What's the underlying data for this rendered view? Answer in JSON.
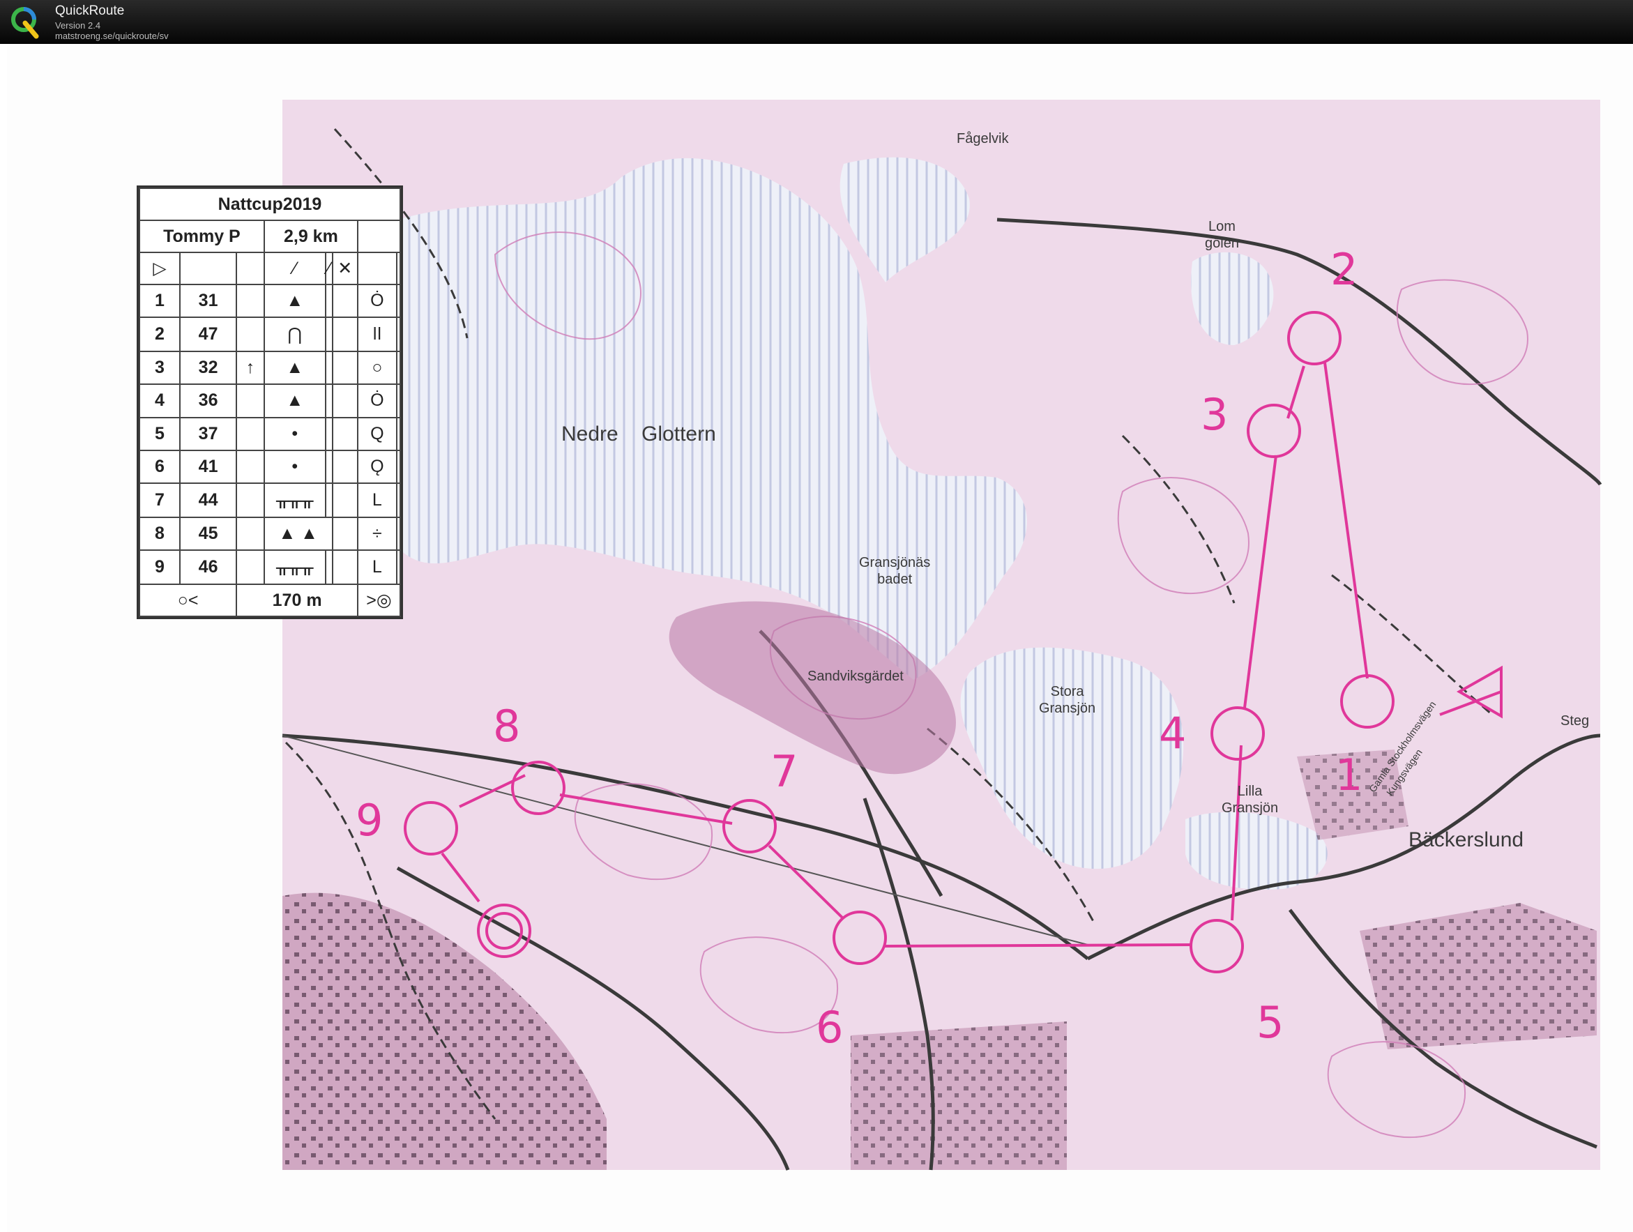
{
  "app": {
    "name": "QuickRoute",
    "version": "Version 2.4",
    "url": "matstroeng.se/quickroute/sv"
  },
  "colors": {
    "course": "#e0379a",
    "map_pink": "#d98fc4",
    "titlebar": "#111111"
  },
  "map_labels": {
    "nedre_glottern": "Nedre    Glottern",
    "fagelvik": "Fågelvik",
    "lom_golen": "Lom\ngölen",
    "gransjonas_badet": "Gransjönäs\nbadet",
    "sandviksgardet": "Sandviksgärdet",
    "stora_gransjon": "Stora\nGransjön",
    "lilla_gransjon": "Lilla\nGransjön",
    "backerslund": "Bäckerslund",
    "steg": "Steg",
    "gamla_stockholmsvagen": "Gamla Stockholmsvägen",
    "kungsvagen": "Kungsvägen"
  },
  "controls": [
    "1",
    "2",
    "3",
    "4",
    "5",
    "6",
    "7",
    "8",
    "9"
  ],
  "description": {
    "event": "Nattcup2019",
    "runner": "Tommy P",
    "length": "2,9 km",
    "rows": [
      {
        "n": "1",
        "code": "31",
        "feature": "▲",
        "where": "Ȯ"
      },
      {
        "n": "2",
        "code": "47",
        "feature": "⋂",
        "where": "ǀǀ"
      },
      {
        "n": "3",
        "code": "32",
        "feature": "▲",
        "where": "○"
      },
      {
        "n": "4",
        "code": "36",
        "feature": "▲",
        "where": "Ȯ"
      },
      {
        "n": "5",
        "code": "37",
        "feature": "•",
        "where": "Q"
      },
      {
        "n": "6",
        "code": "41",
        "feature": "•",
        "where": "Ǫ"
      },
      {
        "n": "7",
        "code": "44",
        "feature": "ᚂᚂᚂ",
        "where": "L"
      },
      {
        "n": "8",
        "code": "45",
        "feature": "▲  ▲",
        "where": "÷"
      },
      {
        "n": "9",
        "code": "46",
        "feature": "ᚂᚂᚂ",
        "where": "L"
      }
    ],
    "finish_distance": "170 m",
    "start_symbol": "▷",
    "col3_extra": "↑"
  }
}
